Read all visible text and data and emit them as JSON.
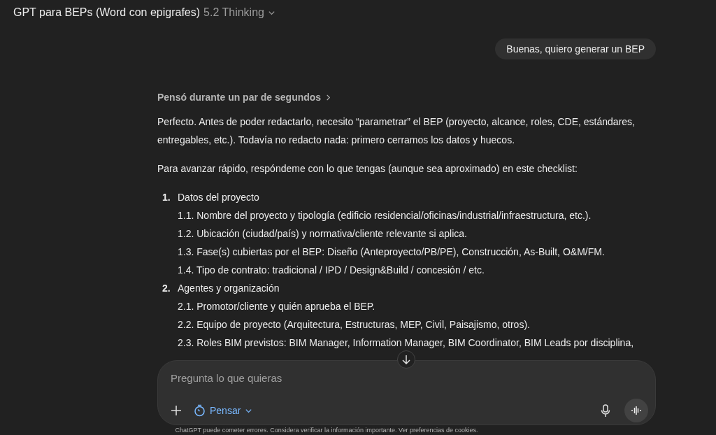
{
  "header": {
    "title": "GPT para BEPs (Word con epigrafes)",
    "model": "5.2 Thinking"
  },
  "user_message": "Buenas, quiero generar un BEP",
  "thinking": {
    "label": "Pensó durante un par de segundos",
    "expanded": false
  },
  "paragraphs": [
    "Perfecto. Antes de poder redactarlo, necesito “parametrar” el BEP (proyecto, alcance, roles, CDE, estándares, entregables, etc.). Todavía no redacto nada: primero cerramos los datos y huecos.",
    "Para avanzar rápido, respóndeme con lo que tengas (aunque sea aproximado) en este checklist:"
  ],
  "checklist": [
    {
      "number": "1.",
      "title": "Datos del proyecto",
      "items": [
        {
          "number": "1.1.",
          "text": "Nombre del proyecto y tipología (edificio residencial/oficinas/industrial/infraestructura, etc.)."
        },
        {
          "number": "1.2.",
          "text": "Ubicación (ciudad/país) y normativa/cliente relevante si aplica."
        },
        {
          "number": "1.3.",
          "text": "Fase(s) cubiertas por el BEP: Diseño (Anteproyecto/PB/PE), Construcción, As-Built, O&M/FM."
        },
        {
          "number": "1.4.",
          "text": "Tipo de contrato: tradicional / IPD / Design&Build / concesión / etc."
        }
      ]
    },
    {
      "number": "2.",
      "title": "Agentes y organización",
      "items": [
        {
          "number": "2.1.",
          "text": "Promotor/cliente y quién aprueba el BEP."
        },
        {
          "number": "2.2.",
          "text": "Equipo de proyecto (Arquitectura, Estructuras, MEP, Civil, Paisajismo, otros)."
        },
        {
          "number": "2.3.",
          "text": "Roles BIM previstos: BIM Manager, Information Manager, BIM Coordinator, BIM Leads por disciplina,"
        }
      ]
    }
  ],
  "composer": {
    "placeholder": "Pregunta lo que quieras",
    "mode": "Pensar"
  },
  "footer": "ChatGPT puede cometer errores. Considera verificar la información importante. Ver preferencias de cookies."
}
